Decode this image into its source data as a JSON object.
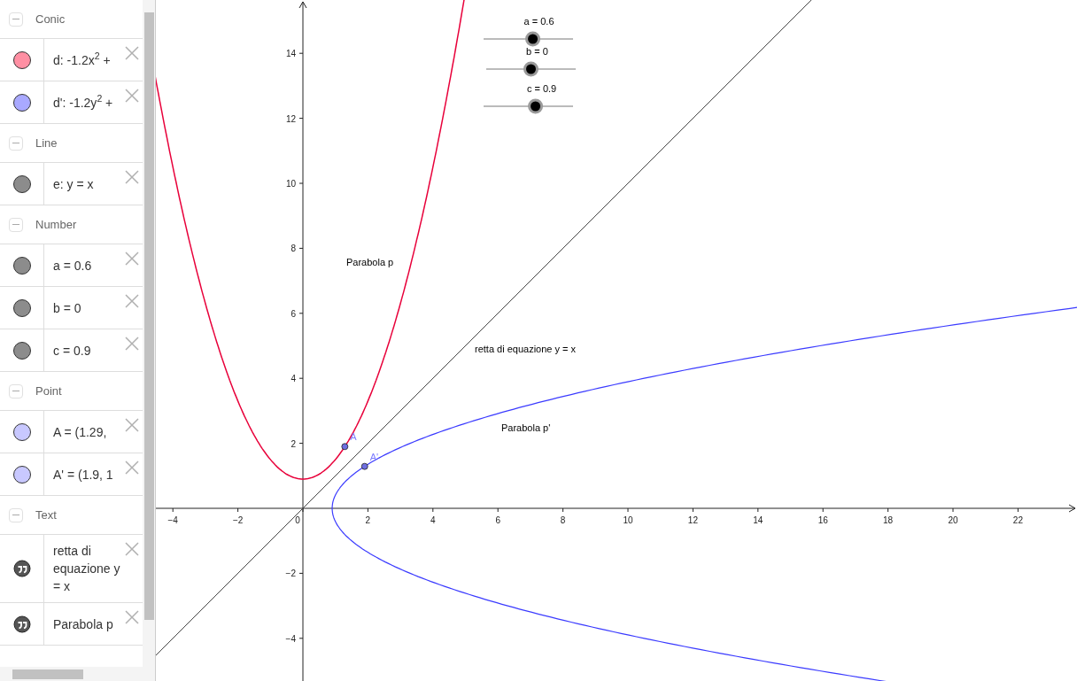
{
  "algebra_view": {
    "groups": [
      {
        "title": "Conic",
        "expanded": true,
        "items": [
          {
            "kind": "object",
            "label": "d: -1.2x$^{2}$ +",
            "color": "#ff8fa3"
          },
          {
            "kind": "object",
            "label": "d': -1.2y$^{2}$ +",
            "color": "#a9a9ff"
          }
        ]
      },
      {
        "title": "Line",
        "expanded": true,
        "items": [
          {
            "kind": "object",
            "label": "e: y = x",
            "color": "#8c8c8c"
          }
        ]
      },
      {
        "title": "Number",
        "expanded": true,
        "items": [
          {
            "kind": "object",
            "label": "a = 0.6",
            "color": "#8c8c8c"
          },
          {
            "kind": "object",
            "label": "b = 0",
            "color": "#8c8c8c"
          },
          {
            "kind": "object",
            "label": "c = 0.9",
            "color": "#8c8c8c"
          }
        ]
      },
      {
        "title": "Point",
        "expanded": true,
        "items": [
          {
            "kind": "object",
            "label": "A = (1.29,",
            "color": "#c8c8ff"
          },
          {
            "kind": "object",
            "label": "A' = (1.9, 1",
            "color": "#c8c8ff"
          }
        ]
      },
      {
        "title": "Text",
        "expanded": true,
        "items": [
          {
            "kind": "text",
            "label": "retta di equazione y = x"
          },
          {
            "kind": "text",
            "label": "Parabola p"
          }
        ]
      }
    ]
  },
  "graphics_view": {
    "x_ticks": [
      "−4",
      "−2",
      "0",
      "2",
      "4",
      "6",
      "8",
      "10",
      "12",
      "14",
      "16",
      "18",
      "20",
      "22"
    ],
    "y_ticks_positive": [
      "14",
      "12",
      "10",
      "8",
      "6",
      "4",
      "2"
    ],
    "y_ticks_negative": [
      "−2",
      "−4"
    ],
    "sliders": [
      {
        "label": "a = 0.6",
        "level": 0.55
      },
      {
        "label": "b = 0",
        "level": 0.5
      },
      {
        "label": "c = 0.9",
        "level": 0.58
      }
    ],
    "texts": [
      {
        "text": "Parabola p"
      },
      {
        "text": "retta di equazione y = x"
      },
      {
        "text": "Parabola p'"
      }
    ],
    "points": [
      {
        "label": "A"
      },
      {
        "label": "A'"
      }
    ]
  }
}
